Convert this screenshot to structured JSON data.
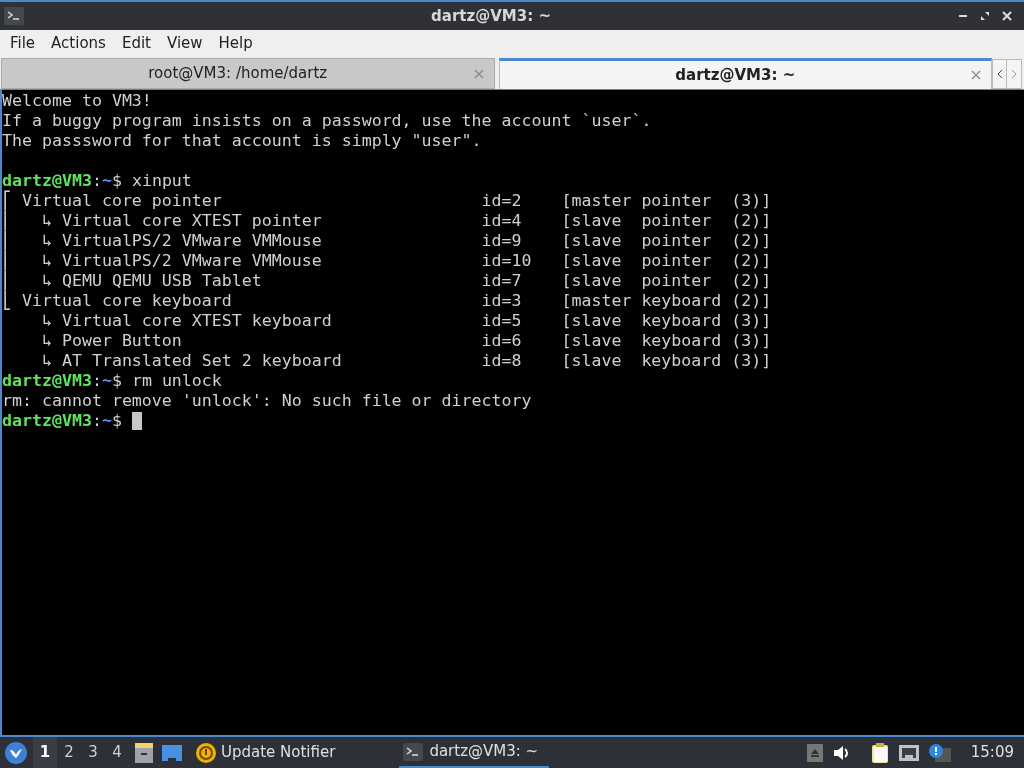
{
  "window": {
    "title": "dartz@VM3: ~"
  },
  "menu": [
    "File",
    "Actions",
    "Edit",
    "View",
    "Help"
  ],
  "tabs": [
    {
      "label": "root@VM3: /home/dartz",
      "selected": false
    },
    {
      "label": "dartz@VM3: ~",
      "selected": true
    }
  ],
  "terminal": {
    "lines": [
      {
        "kind": "text",
        "text": "Welcome to VM3!"
      },
      {
        "kind": "text",
        "text": "If a buggy program insists on a password, use the account `user`."
      },
      {
        "kind": "text",
        "text": "The passsword for that account is simply \"user\"."
      },
      {
        "kind": "blank"
      },
      {
        "kind": "prompt",
        "user_host": "dartz@VM3",
        "sep": ":",
        "path": "~",
        "symbol": "$",
        "command": "xinput"
      },
      {
        "kind": "device",
        "device": "⎡ Virtual core pointer",
        "id": "id=2",
        "role": "[master pointer  (3)]"
      },
      {
        "kind": "device",
        "device": "⎜   ↳ Virtual core XTEST pointer",
        "id": "id=4",
        "role": "[slave  pointer  (2)]"
      },
      {
        "kind": "device",
        "device": "⎜   ↳ VirtualPS/2 VMware VMMouse",
        "id": "id=9",
        "role": "[slave  pointer  (2)]"
      },
      {
        "kind": "device",
        "device": "⎜   ↳ VirtualPS/2 VMware VMMouse",
        "id": "id=10",
        "role": "[slave  pointer  (2)]"
      },
      {
        "kind": "device",
        "device": "⎜   ↳ QEMU QEMU USB Tablet",
        "id": "id=7",
        "role": "[slave  pointer  (2)]"
      },
      {
        "kind": "device",
        "device": "⎣ Virtual core keyboard",
        "id": "id=3",
        "role": "[master keyboard (2)]"
      },
      {
        "kind": "device",
        "device": "    ↳ Virtual core XTEST keyboard",
        "id": "id=5",
        "role": "[slave  keyboard (3)]"
      },
      {
        "kind": "device",
        "device": "    ↳ Power Button",
        "id": "id=6",
        "role": "[slave  keyboard (3)]"
      },
      {
        "kind": "device",
        "device": "    ↳ AT Translated Set 2 keyboard",
        "id": "id=8",
        "role": "[slave  keyboard (3)]"
      },
      {
        "kind": "prompt",
        "user_host": "dartz@VM3",
        "sep": ":",
        "path": "~",
        "symbol": "$",
        "command": "rm unlock"
      },
      {
        "kind": "text",
        "text": "rm: cannot remove 'unlock': No such file or directory"
      },
      {
        "kind": "prompt",
        "user_host": "dartz@VM3",
        "sep": ":",
        "path": "~",
        "symbol": "$",
        "cursor": true
      }
    ]
  },
  "taskbar": {
    "desktops": [
      {
        "label": "1",
        "selected": true
      },
      {
        "label": "2",
        "selected": false
      },
      {
        "label": "3",
        "selected": false
      },
      {
        "label": "4",
        "selected": false
      }
    ],
    "tasks": [
      {
        "kind": "notifier",
        "label": "Update Notifier",
        "active": false
      },
      {
        "kind": "terminal",
        "label": "dartz@VM3: ~",
        "active": true
      }
    ],
    "clock": "15:09"
  }
}
